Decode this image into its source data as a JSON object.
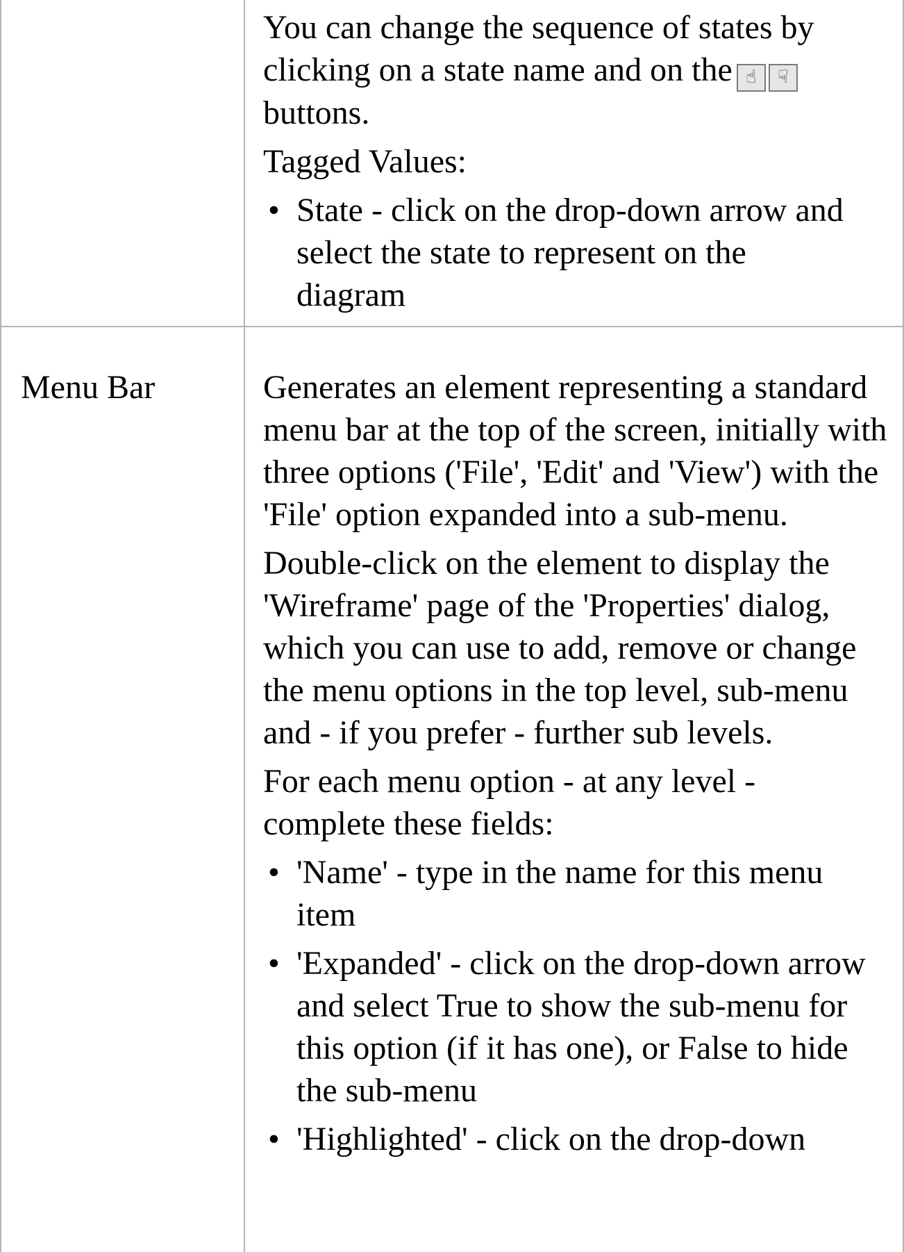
{
  "rows": [
    {
      "label": "",
      "paragraphs": [
        "You can change the sequence of states by clicking on a state name and on the",
        "buttons.",
        "Tagged Values:"
      ],
      "bullets": [
        "State - click on the drop-down arrow and select the state to represent on the diagram"
      ],
      "icons": [
        "move-up-icon",
        "move-down-icon"
      ]
    },
    {
      "label": "Menu Bar",
      "paragraphs": [
        "Generates an element representing a standard menu bar at the top of the screen, initially with three options ('File', 'Edit' and 'View') with the 'File' option expanded into a sub-menu.",
        "Double-click on the element to display the 'Wireframe' page of the 'Properties' dialog, which you can use to add, remove or change the menu options in the top level, sub-menu and - if you prefer - further sub levels.",
        "For each menu option - at any level - complete these fields:"
      ],
      "bullets": [
        "'Name' - type in the name for this menu item",
        "'Expanded' - click on the drop-down arrow and select True to show the sub-menu for this option (if it has one), or False to hide the sub-menu",
        "'Highlighted' - click on the drop-down"
      ]
    }
  ],
  "colors": {
    "grid": "#b4b4b4",
    "text": "#000000",
    "background": "#ffffff"
  }
}
